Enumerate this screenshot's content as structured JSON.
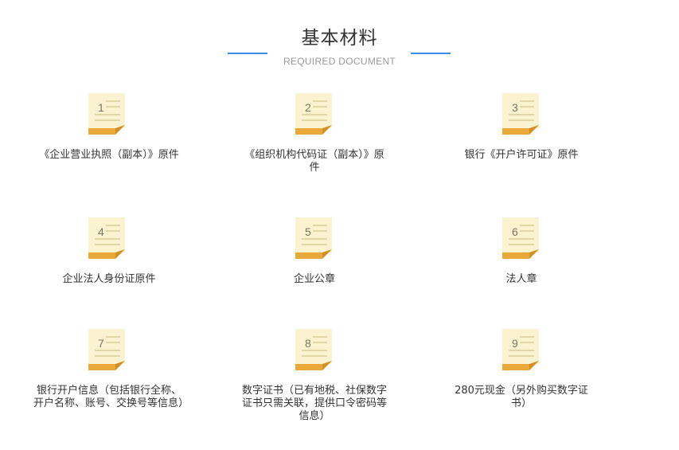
{
  "header": {
    "title": "基本材料",
    "subtitle": "REQUIRED DOCUMENT",
    "accent_color": "#3a8ee6"
  },
  "documents": [
    {
      "number": "1",
      "label": "《企业营业执照（副本）》原件"
    },
    {
      "number": "2",
      "label": "《组织机构代码证（副本）》原件"
    },
    {
      "number": "3",
      "label": "银行《开户许可证》原件"
    },
    {
      "number": "4",
      "label": "企业法人身份证原件"
    },
    {
      "number": "5",
      "label": "企业公章"
    },
    {
      "number": "6",
      "label": "法人章"
    },
    {
      "number": "7",
      "label": "银行开户信息（包括银行全称、开户名称、账号、交换号等信息）"
    },
    {
      "number": "8",
      "label": "数字证书（已有地税、社保数字证书只需关联，提供口令密码等信息）"
    },
    {
      "number": "9",
      "label": "280元现金（另外购买数字证书）"
    }
  ],
  "icon": {
    "name": "document-icon",
    "paper_color": "#fbf3cf",
    "fold_color": "#e9a93a",
    "line_color": "#e2d6a6"
  }
}
